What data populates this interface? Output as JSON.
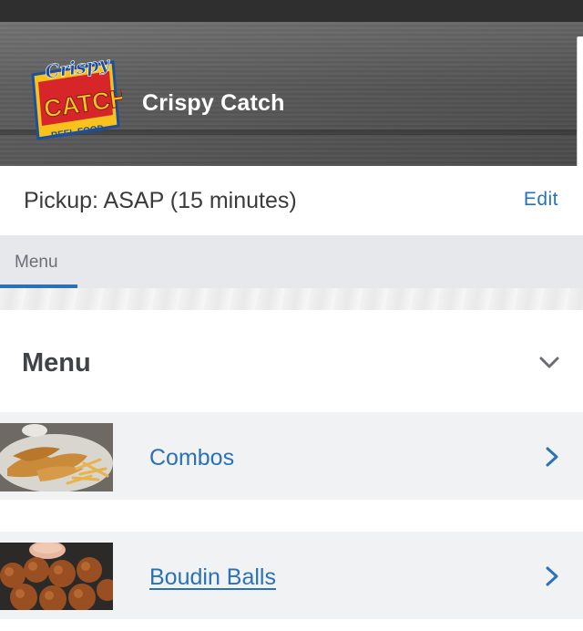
{
  "header": {
    "restaurant_name": "Crispy Catch",
    "logo": {
      "script_text": "Crispy",
      "main_text": "CATCH",
      "tagline": "REEL FOOD"
    }
  },
  "pickup": {
    "text": "Pickup: ASAP (15 minutes)",
    "edit_label": "Edit"
  },
  "tabs": [
    {
      "label": "Menu",
      "active": true
    }
  ],
  "menu_section": {
    "title": "Menu",
    "chevron_icon": "chevron-down-icon",
    "items": [
      {
        "label": "Combos",
        "icon": "chevron-right-icon",
        "underlined": false
      },
      {
        "label": "Boudin Balls",
        "icon": "chevron-right-icon",
        "underlined": true
      }
    ]
  },
  "colors": {
    "accent": "#2a72b5",
    "header_bg": "#555555",
    "tab_bg": "#e6e8ec",
    "row_bg": "#f0f2f4",
    "logo_yellow": "#f7c21b",
    "logo_red": "#d7262a",
    "logo_blue": "#1d4f9c"
  }
}
